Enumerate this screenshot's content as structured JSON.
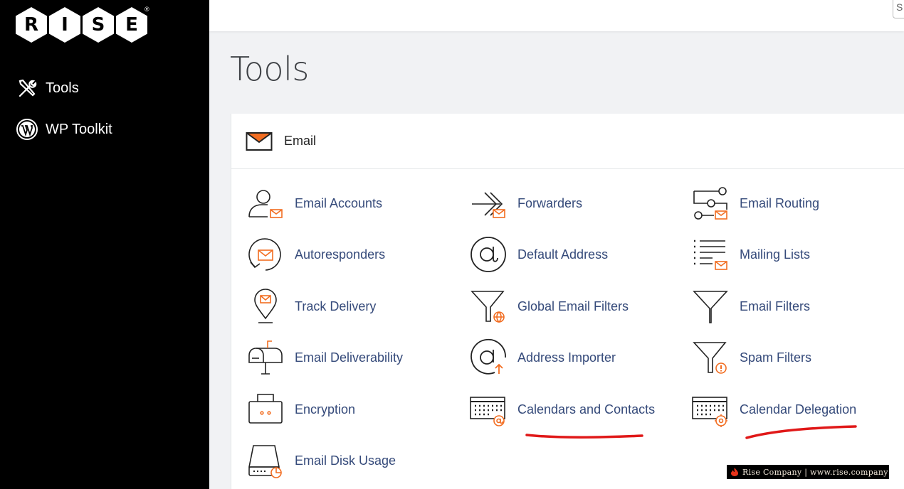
{
  "brand": {
    "letters": [
      "R",
      "I",
      "S",
      "E"
    ],
    "registered": "®"
  },
  "sidebar": {
    "items": [
      {
        "label": "Tools",
        "icon": "tools-icon"
      },
      {
        "label": "WP Toolkit",
        "icon": "wordpress-icon"
      }
    ]
  },
  "topbar": {
    "search_stub": "S"
  },
  "page": {
    "title": "Tools"
  },
  "section": {
    "title": "Email",
    "icon": "envelope-icon"
  },
  "tools": [
    {
      "label": "Email Accounts",
      "icon": "email-accounts-icon"
    },
    {
      "label": "Forwarders",
      "icon": "forwarders-icon"
    },
    {
      "label": "Email Routing",
      "icon": "email-routing-icon"
    },
    {
      "label": "Autoresponders",
      "icon": "autoresponders-icon"
    },
    {
      "label": "Default Address",
      "icon": "at-sign-icon"
    },
    {
      "label": "Mailing Lists",
      "icon": "mailing-lists-icon"
    },
    {
      "label": "Track Delivery",
      "icon": "track-delivery-icon"
    },
    {
      "label": "Global Email Filters",
      "icon": "global-filter-icon"
    },
    {
      "label": "Email Filters",
      "icon": "filter-icon"
    },
    {
      "label": "Email Deliverability",
      "icon": "mailbox-icon"
    },
    {
      "label": "Address Importer",
      "icon": "address-importer-icon"
    },
    {
      "label": "Spam Filters",
      "icon": "spam-filter-icon"
    },
    {
      "label": "Encryption",
      "icon": "encryption-icon"
    },
    {
      "label": "Calendars and Contacts",
      "icon": "calendar-contacts-icon"
    },
    {
      "label": "Calendar Delegation",
      "icon": "calendar-delegation-icon"
    },
    {
      "label": "Email Disk Usage",
      "icon": "disk-usage-icon"
    }
  ],
  "colors": {
    "accent": "#f26d21",
    "link": "#354a7a",
    "annotation": "#e01818"
  },
  "watermark": {
    "text": "Rise Company | www.rise.company"
  }
}
